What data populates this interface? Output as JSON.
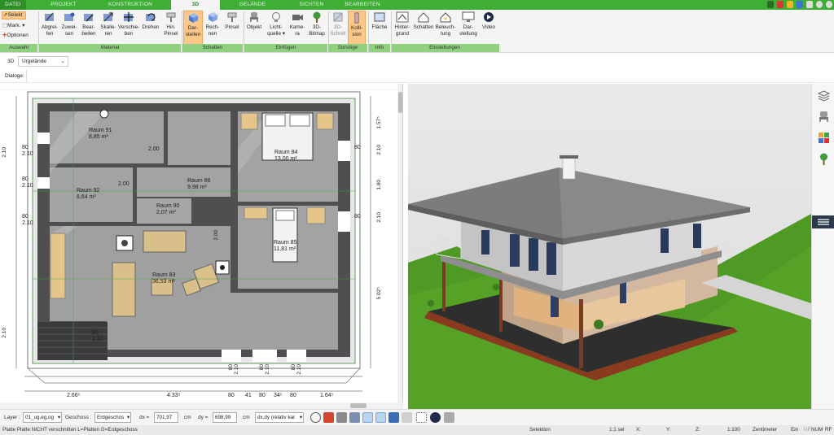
{
  "tabs": {
    "datei": "DATEI",
    "projekt": "PROJEKT",
    "konstruktion": "KONSTRUKTION",
    "d3": "3D",
    "gelaende": "GELÄNDE",
    "sichten": "SICHTEN",
    "bearbeiten": "BEARBEITEN"
  },
  "ribbon": {
    "auswahl": {
      "selekt": "Selekt",
      "mark": "Mark.",
      "optionen": "Optionen",
      "group": "Auswahl"
    },
    "material": {
      "group": "Material",
      "buttons": [
        {
          "l1": "Abgrei-",
          "l2": "fen"
        },
        {
          "l1": "Zuwei-",
          "l2": "sen"
        },
        {
          "l1": "Bear-",
          "l2": "beiten"
        },
        {
          "l1": "Skalie-",
          "l2": "ren"
        },
        {
          "l1": "Verschie-",
          "l2": "ben"
        },
        {
          "l1": "Drehen",
          "l2": ""
        },
        {
          "l1": "Hin.",
          "l2": "Pinsel"
        }
      ]
    },
    "schatten": {
      "group": "Schatten",
      "buttons": [
        {
          "l1": "Dar-",
          "l2": "stellen"
        },
        {
          "l1": "Rech-",
          "l2": "nen"
        },
        {
          "l1": "Pinsel",
          "l2": ""
        }
      ]
    },
    "einfuegen": {
      "group": "Einfügen",
      "buttons": [
        {
          "l1": "Objekt",
          "l2": ""
        },
        {
          "l1": "Licht-",
          "l2": "quelle ▾"
        },
        {
          "l1": "Kame-",
          "l2": "ra"
        },
        {
          "l1": "3D-",
          "l2": "Bitmap"
        }
      ]
    },
    "sonstige": {
      "group": "Sonstige",
      "buttons": [
        {
          "l1": "3D-",
          "l2": "Schnitt"
        },
        {
          "l1": "Kolli-",
          "l2": "sion"
        }
      ]
    },
    "info": {
      "group": "Info",
      "flaeche": "Fläche"
    },
    "einstellungen": {
      "group": "Einstellungen",
      "buttons": [
        {
          "l1": "Hinter-",
          "l2": "grund"
        },
        {
          "l1": "Schatten",
          "l2": ""
        },
        {
          "l1": "Beleuch-",
          "l2": "tung"
        },
        {
          "l1": "Dar-",
          "l2": "stellung"
        },
        {
          "l1": "Video",
          "l2": ""
        }
      ]
    }
  },
  "viewbar": {
    "mode": "3D",
    "terrain": "Urgelände"
  },
  "dialogbar": {
    "label": "Dialoge:"
  },
  "plan": {
    "rooms": [
      {
        "name": "Raum 91",
        "area": "8,85 m²"
      },
      {
        "name": "Raum 92",
        "area": "6,64 m²"
      },
      {
        "name": "Raum 86",
        "area": "9,98 m²"
      },
      {
        "name": "Raum 90",
        "area": "2,07 m²"
      },
      {
        "name": "Raum 84",
        "area": "13,00 m²"
      },
      {
        "name": "Raum 85",
        "area": "11,81 m²"
      },
      {
        "name": "Raum 83",
        "area": "36,53 m²"
      }
    ],
    "bottom_dims": [
      "2.66⁵",
      "4.33⁵",
      "80",
      "41",
      "80",
      "34⁵",
      "80",
      "1.64⁵"
    ],
    "right_dims": [
      "1.57⁵",
      "80",
      "2.10",
      "1.80",
      "80",
      "2.10",
      "5.02⁵"
    ],
    "left_dims": [
      "80",
      "2.10",
      "80",
      "2.10",
      "2.10",
      "80",
      "2.10",
      "2.10"
    ],
    "door_labels": [
      "2.00",
      "2.00",
      "2.00",
      "80",
      "2.10"
    ],
    "bottom_door_dims": [
      "80",
      "2.10",
      "80",
      "2.10",
      "80",
      "2.10"
    ]
  },
  "bottombar": {
    "layer_label": "Layer :",
    "layer_value": "01_ug,eg,og",
    "geschoss_label": "Geschoss :",
    "geschoss_value": "Erdgeschos",
    "dx_label": "dx =",
    "dx_value": "701,97",
    "dy_label": "dy =",
    "dy_value": "698,99",
    "unit": "cm",
    "coord_mode": "dx,dy (relativ kar"
  },
  "statusbar": {
    "message": "Platte Platte NICHT verschnitten L=Platten G=Erdgeschoss",
    "mode": "Selektion",
    "sel": "1:1 sel",
    "x": "X:",
    "y": "Y:",
    "z": "Z:",
    "scale": "1:100",
    "unit": "Zentimeter",
    "ein": "Ein",
    "uf": "UF",
    "num": "NUM",
    "rf": "RF"
  },
  "colors": {
    "accent": "#3fae35",
    "active_button": "#fbc78a",
    "group_label": "#8fd17f"
  }
}
